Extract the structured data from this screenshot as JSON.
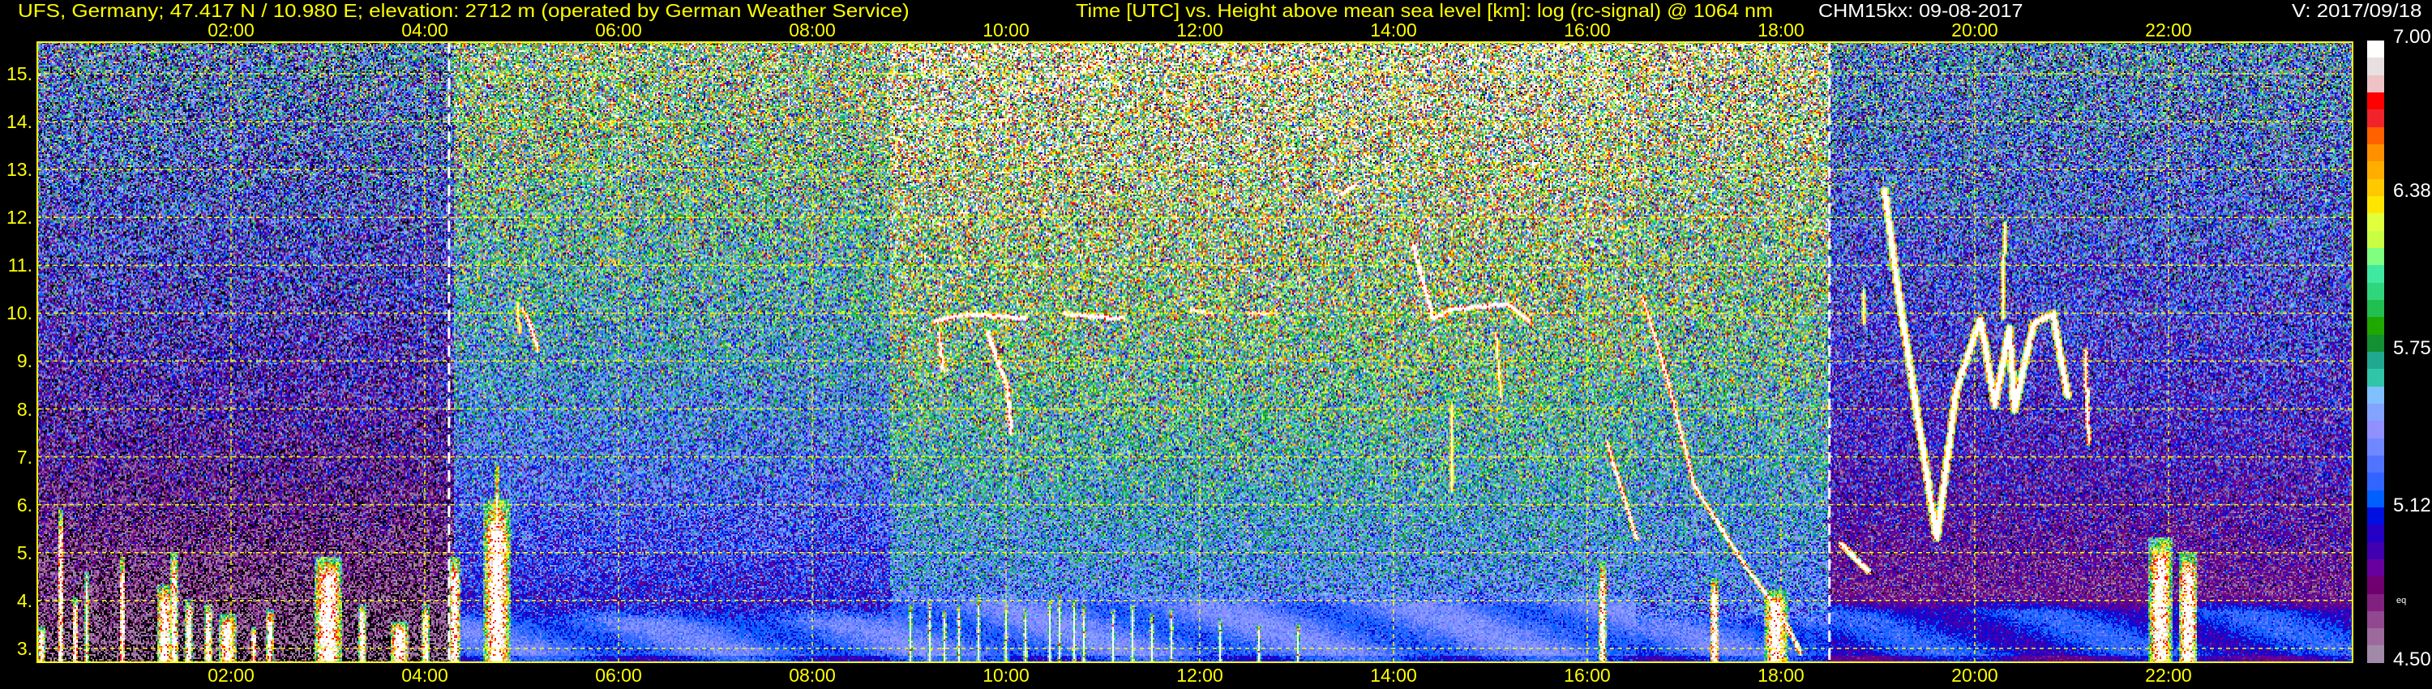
{
  "header": {
    "station": "UFS, Germany; 47.417 N / 10.980 E; elevation: 2712 m  (operated by German Weather Service)",
    "axes_description": "Time [UTC] vs. Height above mean sea level [km]: log (rc-signal) @ 1064 nm",
    "instrument_date": "CHM15kx: 09-08-2017",
    "version": "V: 2017/09/18"
  },
  "colors": {
    "text_primary": "#ffff00",
    "text_secondary": "#ffffff",
    "grid": "#ffff00",
    "marker": "#ffffff",
    "background": "#000000"
  },
  "chart_data": {
    "type": "heatmap",
    "title": "Time [UTC] vs. Height above mean sea level [km]: log (rc-signal) @ 1064 nm",
    "xlabel": "Time [UTC]",
    "ylabel": "Height above mean sea level [km]",
    "xlim": [
      0,
      23.9
    ],
    "ylim": [
      2.71,
      15.66
    ],
    "grid": true,
    "xticks": [
      {
        "value": 2,
        "label": "02:00"
      },
      {
        "value": 4,
        "label": "04:00"
      },
      {
        "value": 6,
        "label": "06:00"
      },
      {
        "value": 8,
        "label": "08:00"
      },
      {
        "value": 10,
        "label": "10:00"
      },
      {
        "value": 12,
        "label": "12:00"
      },
      {
        "value": 14,
        "label": "14:00"
      },
      {
        "value": 16,
        "label": "16:00"
      },
      {
        "value": 18,
        "label": "18:00"
      },
      {
        "value": 20,
        "label": "20:00"
      },
      {
        "value": 22,
        "label": "22:00"
      }
    ],
    "yticks": [
      {
        "value": 3,
        "label": "3."
      },
      {
        "value": 4,
        "label": "4."
      },
      {
        "value": 5,
        "label": "5."
      },
      {
        "value": 6,
        "label": "6."
      },
      {
        "value": 7,
        "label": "7."
      },
      {
        "value": 8,
        "label": "8."
      },
      {
        "value": 9,
        "label": "9."
      },
      {
        "value": 10,
        "label": "10."
      },
      {
        "value": 11,
        "label": "11."
      },
      {
        "value": 12,
        "label": "12."
      },
      {
        "value": 13,
        "label": "13."
      },
      {
        "value": 14,
        "label": "14."
      },
      {
        "value": 15,
        "label": "15."
      }
    ],
    "day_night_markers_utc": [
      4.25,
      18.5
    ],
    "colorbar": {
      "min": 4.5,
      "max": 7.0,
      "ticks": [
        {
          "value": 7.0,
          "label": "7.00"
        },
        {
          "value": 6.38,
          "label": "6.38"
        },
        {
          "value": 5.75,
          "label": "5.75"
        },
        {
          "value": 5.12,
          "label": "5.12"
        },
        {
          "value": 4.5,
          "label": "4.50"
        }
      ],
      "note": {
        "value": 4.75,
        "label": "eq"
      },
      "colors_top_to_bottom": [
        "#ffffff",
        "#e8dfe0",
        "#efc3c5",
        "#ff0000",
        "#f0242a",
        "#ff6000",
        "#ff9000",
        "#ffae00",
        "#ffc800",
        "#ffe600",
        "#e0ff3c",
        "#c8ff44",
        "#80ff80",
        "#40e8a0",
        "#30d67c",
        "#20bf50",
        "#1ea800",
        "#129032",
        "#20a890",
        "#30c4a8",
        "#80c0ff",
        "#82a4ff",
        "#9090ff",
        "#7088ff",
        "#5074ff",
        "#3264ff",
        "#0060ff",
        "#0010e0",
        "#2400c4",
        "#4000b0",
        "#6800a0",
        "#700070",
        "#802080",
        "#904890",
        "#9c6a9c",
        "#a08aa8"
      ]
    },
    "background_regimes": [
      {
        "from": 0.0,
        "to": 4.3,
        "bottom_mean": 4.5,
        "top_mean": 5.35,
        "bottom_sd": 0.12,
        "top_sd": 0.6,
        "pbl_top": 0,
        "pbl_mean": 0
      },
      {
        "from": 4.3,
        "to": 8.8,
        "bottom_mean": 4.95,
        "top_mean": 6.1,
        "bottom_sd": 0.12,
        "top_sd": 0.7,
        "pbl_top": 3.9,
        "pbl_mean": 5.27
      },
      {
        "from": 8.8,
        "to": 16.5,
        "bottom_mean": 5.25,
        "top_mean": 6.5,
        "bottom_sd": 0.18,
        "top_sd": 0.9,
        "pbl_top": 4.2,
        "pbl_mean": 5.3
      },
      {
        "from": 16.5,
        "to": 18.5,
        "bottom_mean": 5.2,
        "top_mean": 6.35,
        "bottom_sd": 0.18,
        "top_sd": 0.85,
        "pbl_top": 3.8,
        "pbl_mean": 5.25
      },
      {
        "from": 18.5,
        "to": 23.9,
        "bottom_mean": 4.7,
        "top_mean": 5.4,
        "bottom_sd": 0.1,
        "top_sd": 0.55,
        "pbl_top": 4.1,
        "pbl_mean": 5.12
      }
    ],
    "cloud_columns": [
      {
        "t": 0.03,
        "w": 0.04,
        "top": 3.45
      },
      {
        "t": 0.23,
        "w": 0.03,
        "top": 5.9
      },
      {
        "t": 0.38,
        "w": 0.03,
        "top": 4.05
      },
      {
        "t": 0.51,
        "w": 0.02,
        "top": 4.6
      },
      {
        "t": 0.87,
        "w": 0.03,
        "top": 4.9
      },
      {
        "t": 1.3,
        "w": 0.08,
        "top": 4.3
      },
      {
        "t": 1.4,
        "w": 0.04,
        "top": 5.0
      },
      {
        "t": 1.56,
        "w": 0.04,
        "top": 4.0
      },
      {
        "t": 1.76,
        "w": 0.04,
        "top": 3.9
      },
      {
        "t": 1.95,
        "w": 0.09,
        "top": 3.7
      },
      {
        "t": 2.23,
        "w": 0.03,
        "top": 3.45
      },
      {
        "t": 2.4,
        "w": 0.04,
        "top": 3.8
      },
      {
        "t": 3.0,
        "w": 0.15,
        "top": 4.9
      },
      {
        "t": 3.35,
        "w": 0.04,
        "top": 3.9
      },
      {
        "t": 3.74,
        "w": 0.1,
        "top": 3.55
      },
      {
        "t": 4.0,
        "w": 0.04,
        "top": 3.9
      },
      {
        "t": 4.3,
        "w": 0.06,
        "top": 4.9
      },
      {
        "t": 4.74,
        "w": 0.14,
        "top": 6.1
      },
      {
        "t": 4.74,
        "w": 0.02,
        "top": 6.9
      },
      {
        "t": 9.0,
        "w": 0.015,
        "top": 3.9
      },
      {
        "t": 9.2,
        "w": 0.015,
        "top": 4.0
      },
      {
        "t": 9.35,
        "w": 0.015,
        "top": 3.8
      },
      {
        "t": 9.5,
        "w": 0.015,
        "top": 3.9
      },
      {
        "t": 9.7,
        "w": 0.015,
        "top": 4.1
      },
      {
        "t": 10.0,
        "w": 0.015,
        "top": 3.9
      },
      {
        "t": 10.2,
        "w": 0.015,
        "top": 3.8
      },
      {
        "t": 10.45,
        "w": 0.015,
        "top": 4.0
      },
      {
        "t": 10.55,
        "w": 0.015,
        "top": 4.1
      },
      {
        "t": 10.7,
        "w": 0.015,
        "top": 4.0
      },
      {
        "t": 10.8,
        "w": 0.015,
        "top": 3.9
      },
      {
        "t": 11.1,
        "w": 0.015,
        "top": 3.8
      },
      {
        "t": 11.3,
        "w": 0.015,
        "top": 3.9
      },
      {
        "t": 11.5,
        "w": 0.015,
        "top": 3.7
      },
      {
        "t": 11.7,
        "w": 0.015,
        "top": 3.8
      },
      {
        "t": 12.2,
        "w": 0.012,
        "top": 3.6
      },
      {
        "t": 12.6,
        "w": 0.012,
        "top": 3.5
      },
      {
        "t": 13.0,
        "w": 0.012,
        "top": 3.5
      },
      {
        "t": 16.15,
        "w": 0.04,
        "top": 4.8
      },
      {
        "t": 17.3,
        "w": 0.05,
        "top": 4.45
      },
      {
        "t": 17.95,
        "w": 0.12,
        "top": 4.2
      },
      {
        "t": 21.9,
        "w": 0.12,
        "top": 5.3
      },
      {
        "t": 22.2,
        "w": 0.1,
        "top": 5.0
      }
    ],
    "cloud_strokes": [
      {
        "w": 0.025,
        "points": [
          [
            5.0,
            10.1
          ],
          [
            5.07,
            9.85
          ],
          [
            5.16,
            9.25
          ]
        ]
      },
      {
        "w": 0.02,
        "points": [
          [
            4.95,
            10.2
          ],
          [
            4.97,
            9.6
          ]
        ]
      },
      {
        "w": 0.03,
        "points": [
          [
            9.26,
            9.85
          ],
          [
            9.6,
            10.0
          ],
          [
            10.2,
            9.9
          ]
        ]
      },
      {
        "w": 0.025,
        "points": [
          [
            9.3,
            9.6
          ],
          [
            9.35,
            8.8
          ]
        ]
      },
      {
        "w": 0.03,
        "points": [
          [
            9.8,
            9.6
          ],
          [
            10.0,
            8.5
          ],
          [
            10.05,
            7.5
          ]
        ]
      },
      {
        "w": 0.03,
        "points": [
          [
            10.6,
            10.0
          ],
          [
            11.2,
            9.9
          ]
        ]
      },
      {
        "w": 0.025,
        "points": [
          [
            11.9,
            10.1
          ],
          [
            12.1,
            10.0
          ]
        ]
      },
      {
        "w": 0.025,
        "points": [
          [
            12.5,
            10.0
          ],
          [
            12.75,
            10.0
          ]
        ]
      },
      {
        "w": 0.03,
        "points": [
          [
            13.45,
            12.5
          ],
          [
            13.6,
            12.7
          ]
        ]
      },
      {
        "w": 0.03,
        "points": [
          [
            14.2,
            11.4
          ],
          [
            14.4,
            9.9
          ],
          [
            14.6,
            10.1
          ],
          [
            15.17,
            10.2
          ],
          [
            15.4,
            9.85
          ]
        ]
      },
      {
        "w": 0.02,
        "points": [
          [
            14.6,
            8.1
          ],
          [
            14.6,
            6.3
          ]
        ]
      },
      {
        "w": 0.02,
        "points": [
          [
            15.05,
            9.6
          ],
          [
            15.1,
            8.3
          ]
        ]
      },
      {
        "w": 0.025,
        "points": [
          [
            16.56,
            10.36
          ],
          [
            16.8,
            8.8
          ],
          [
            17.1,
            6.4
          ],
          [
            17.6,
            4.8
          ],
          [
            18.0,
            3.7
          ],
          [
            18.2,
            2.9
          ]
        ]
      },
      {
        "w": 0.025,
        "points": [
          [
            16.2,
            7.3
          ],
          [
            16.4,
            6.0
          ],
          [
            16.5,
            5.3
          ]
        ]
      },
      {
        "w": 0.03,
        "points": [
          [
            18.61,
            5.2
          ],
          [
            18.9,
            4.6
          ]
        ]
      },
      {
        "w": 0.02,
        "points": [
          [
            18.84,
            10.5
          ],
          [
            18.84,
            9.8
          ]
        ]
      },
      {
        "w": 0.04,
        "points": [
          [
            19.06,
            12.6
          ],
          [
            19.2,
            10.5
          ],
          [
            19.6,
            5.3
          ],
          [
            19.8,
            8.4
          ],
          [
            20.05,
            9.9
          ],
          [
            20.2,
            8.1
          ],
          [
            20.35,
            9.7
          ],
          [
            20.4,
            8.0
          ],
          [
            20.6,
            9.8
          ],
          [
            20.8,
            10.0
          ],
          [
            20.95,
            8.3
          ]
        ]
      },
      {
        "w": 0.02,
        "points": [
          [
            20.3,
            11.9
          ],
          [
            20.28,
            9.9
          ]
        ]
      },
      {
        "w": 0.025,
        "points": [
          [
            21.13,
            9.25
          ],
          [
            21.17,
            7.3
          ]
        ]
      }
    ]
  }
}
